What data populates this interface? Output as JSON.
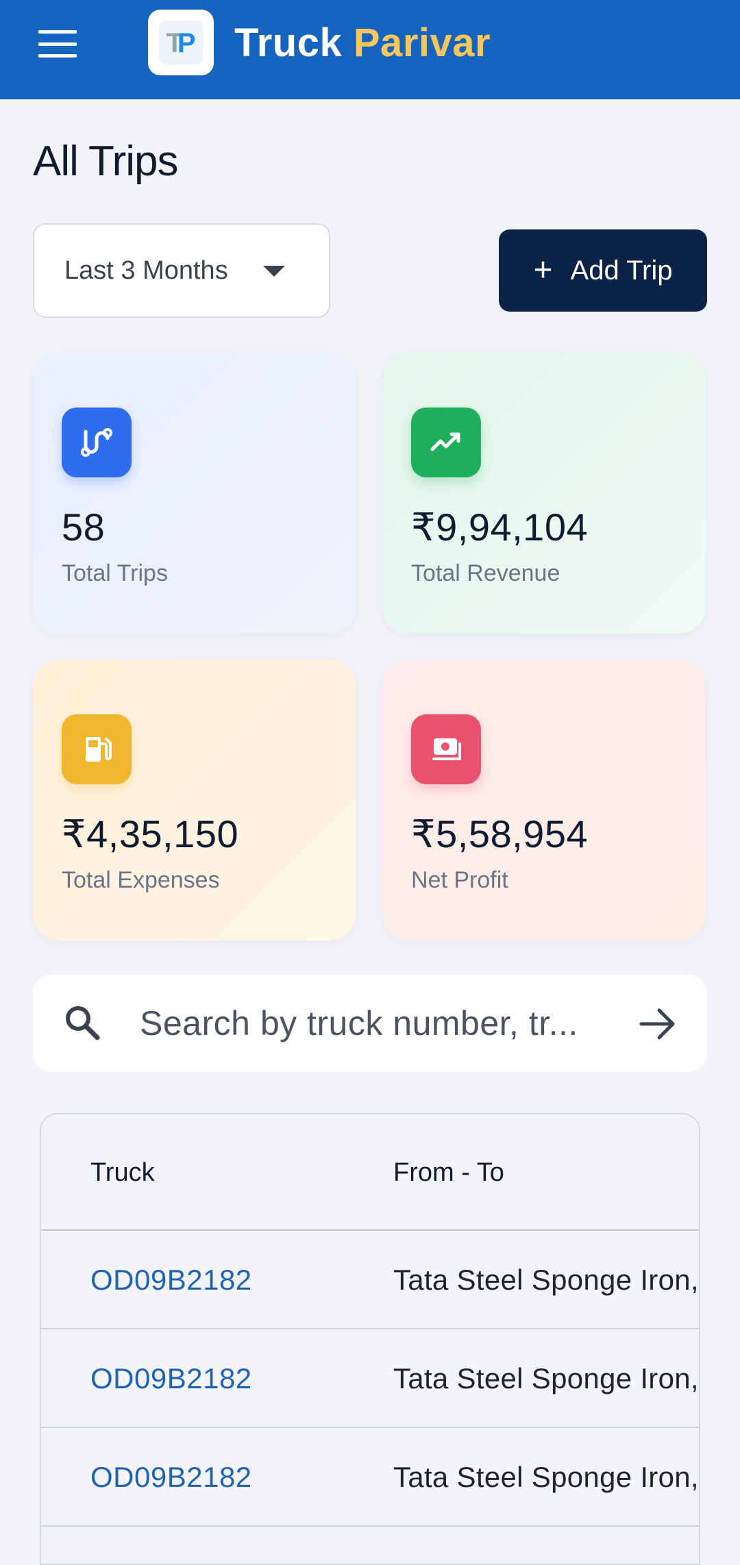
{
  "app": {
    "brand_primary": "Truck",
    "brand_accent": "Parivar",
    "logo_text": "TP",
    "colors": {
      "appbar": "#1565c0",
      "accent": "#f7c75b",
      "primary_button": "#0d2247",
      "link": "#1f62b3"
    }
  },
  "page": {
    "title": "All Trips"
  },
  "filter": {
    "selected": "Last 3 Months"
  },
  "actions": {
    "add_trip": "Add Trip"
  },
  "stats": [
    {
      "value": "58",
      "label": "Total Trips",
      "icon": "route-icon",
      "color": "#2e6cf0"
    },
    {
      "value": "₹9,94,104",
      "label": "Total Revenue",
      "icon": "trending-up-icon",
      "color": "#1fae5c"
    },
    {
      "value": "₹4,35,150",
      "label": "Total Expenses",
      "icon": "fuel-icon",
      "color": "#f0b72e"
    },
    {
      "value": "₹5,58,954",
      "label": "Net Profit",
      "icon": "cash-icon",
      "color": "#e8526d"
    }
  ],
  "search": {
    "placeholder": "Search by truck number, tr..."
  },
  "table": {
    "columns": [
      "Truck",
      "From - To"
    ],
    "rows": [
      {
        "truck": "OD09B2182",
        "route": "Tata Steel Sponge Iron,"
      },
      {
        "truck": "OD09B2182",
        "route": "Tata Steel Sponge Iron,"
      },
      {
        "truck": "OD09B2182",
        "route": "Tata Steel Sponge Iron,"
      }
    ]
  }
}
